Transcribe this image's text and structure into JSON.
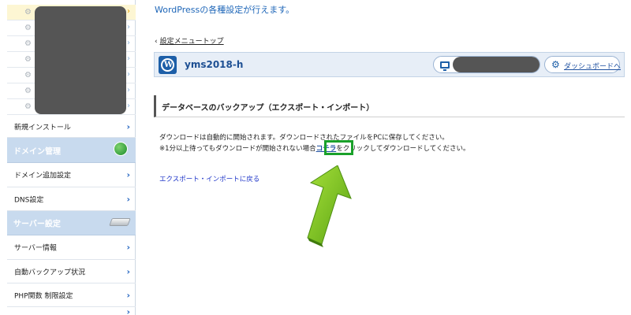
{
  "header": {
    "description": "WordPressの各種設定が行えます。"
  },
  "sidebar": {
    "items": [
      {
        "label": "新規インストール"
      },
      {
        "label": "ドメイン追加設定"
      },
      {
        "label": "DNS設定"
      },
      {
        "label": "サーバー情報"
      },
      {
        "label": "自動バックアップ状況"
      },
      {
        "label": "PHP関数 制限設定"
      }
    ],
    "sections": [
      {
        "label": "ドメイン管理",
        "icon": "globe-icon"
      },
      {
        "label": "サーバー設定",
        "icon": "server-icon"
      }
    ]
  },
  "main": {
    "back_link": "設定メニュートップ",
    "site": {
      "name": "yms2018-h",
      "dashboard_label": "ダッシュボードへ"
    },
    "section_title": "データベースのバックアップ（エクスポート・インポート）",
    "message_line1": "ダウンロードは自動的に開始されます。ダウンロードされたファイルをPCに保存してください。",
    "message_line2_pre": "※1分以上待ってもダウンロードが開始されない場合",
    "message_line2_link": "コチラ",
    "message_line2_post": "をクリックしてダウンロードしてください。",
    "return_link": "エクスポート・インポートに戻る"
  },
  "colors": {
    "accent": "#1e66b8",
    "highlight": "#1aa12a",
    "arrow": "#7cc61d"
  }
}
